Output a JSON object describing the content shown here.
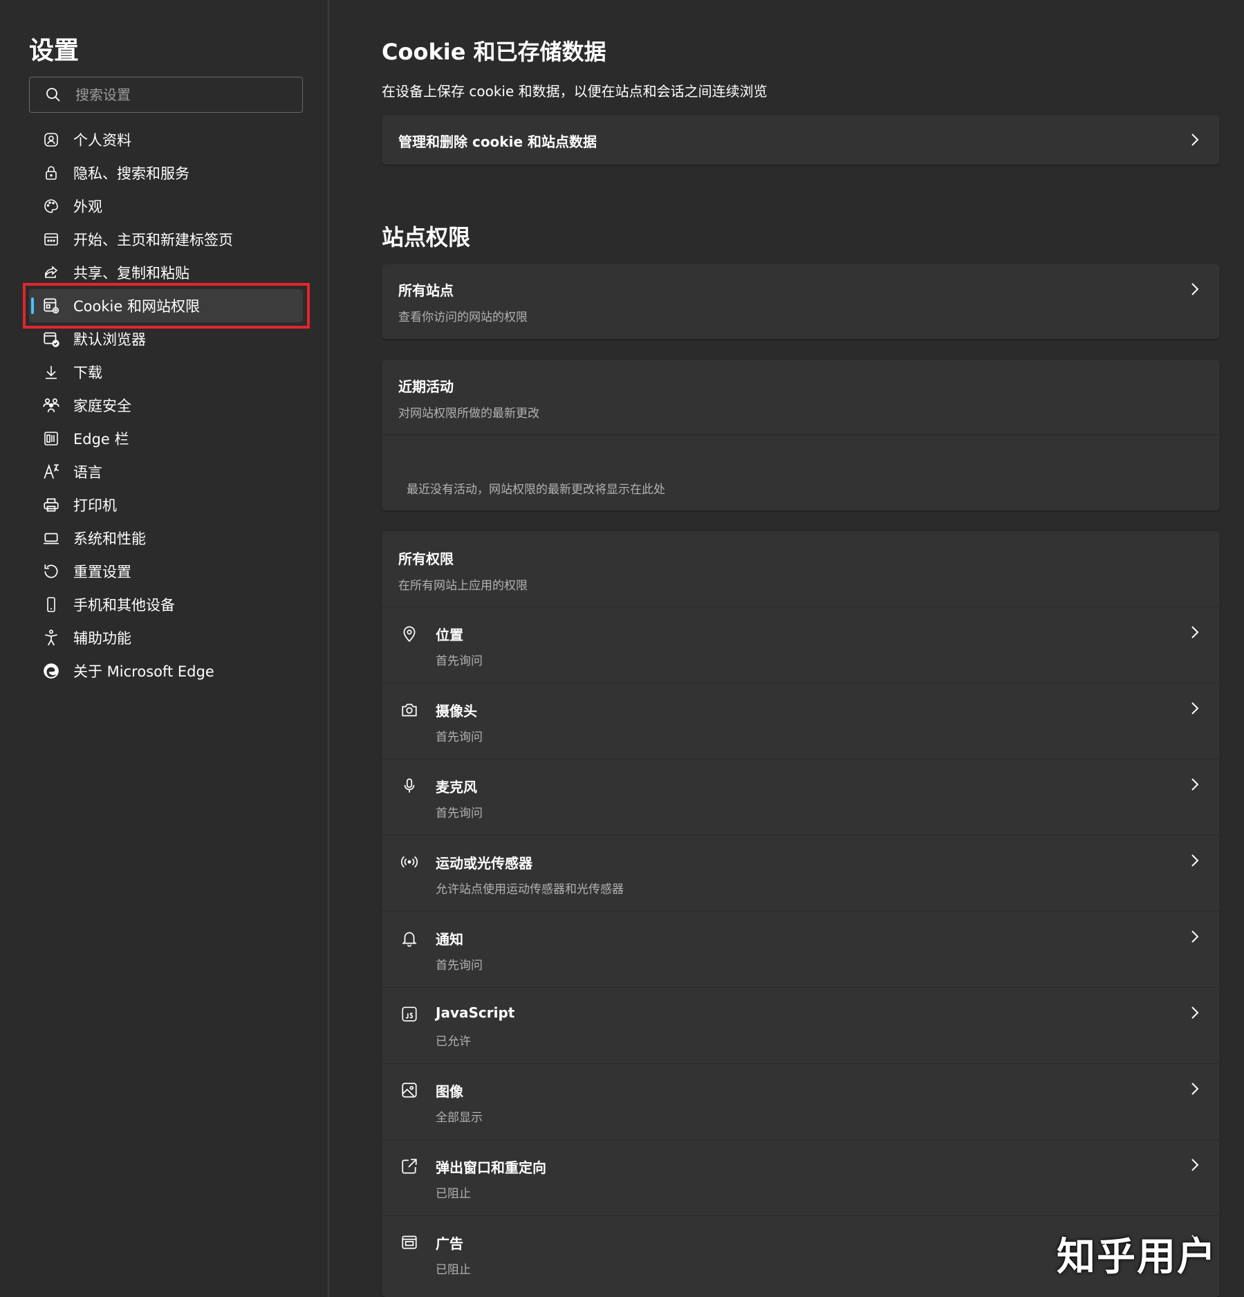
{
  "sidebar": {
    "title": "设置",
    "search_placeholder": "搜索设置",
    "items": [
      {
        "label": "个人资料",
        "icon": "profile-icon"
      },
      {
        "label": "隐私、搜索和服务",
        "icon": "lock-icon"
      },
      {
        "label": "外观",
        "icon": "palette-icon"
      },
      {
        "label": "开始、主页和新建标签页",
        "icon": "start-page-icon"
      },
      {
        "label": "共享、复制和粘贴",
        "icon": "share-icon"
      },
      {
        "label": "Cookie 和网站权限",
        "icon": "site-permissions-icon",
        "active": true
      },
      {
        "label": "默认浏览器",
        "icon": "default-browser-icon"
      },
      {
        "label": "下载",
        "icon": "download-icon"
      },
      {
        "label": "家庭安全",
        "icon": "family-icon"
      },
      {
        "label": "Edge 栏",
        "icon": "edge-bar-icon"
      },
      {
        "label": "语言",
        "icon": "language-icon"
      },
      {
        "label": "打印机",
        "icon": "printer-icon"
      },
      {
        "label": "系统和性能",
        "icon": "laptop-icon"
      },
      {
        "label": "重置设置",
        "icon": "reset-icon"
      },
      {
        "label": "手机和其他设备",
        "icon": "phone-icon"
      },
      {
        "label": "辅助功能",
        "icon": "accessibility-icon"
      },
      {
        "label": "关于 Microsoft Edge",
        "icon": "edge-logo-icon"
      }
    ]
  },
  "main": {
    "cookies": {
      "title": "Cookie 和已存储数据",
      "description": "在设备上保存 cookie 和数据，以便在站点和会话之间连续浏览",
      "manage_label": "管理和删除 cookie 和站点数据"
    },
    "site_permissions": {
      "title": "站点权限",
      "all_sites": {
        "title": "所有站点",
        "subtitle": "查看你访问的网站的权限"
      },
      "recent_activity": {
        "title": "近期活动",
        "subtitle": "对网站权限所做的最新更改",
        "empty_text": "最近没有活动，网站权限的最新更改将显示在此处"
      },
      "all_permissions": {
        "title": "所有权限",
        "subtitle": "在所有网站上应用的权限",
        "items": [
          {
            "title": "位置",
            "subtitle": "首先询问",
            "icon": "location-icon"
          },
          {
            "title": "摄像头",
            "subtitle": "首先询问",
            "icon": "camera-icon"
          },
          {
            "title": "麦克风",
            "subtitle": "首先询问",
            "icon": "microphone-icon"
          },
          {
            "title": "运动或光传感器",
            "subtitle": "允许站点使用运动传感器和光传感器",
            "icon": "sensor-icon"
          },
          {
            "title": "通知",
            "subtitle": "首先询问",
            "icon": "bell-icon"
          },
          {
            "title": "JavaScript",
            "subtitle": "已允许",
            "icon": "javascript-icon"
          },
          {
            "title": "图像",
            "subtitle": "全部显示",
            "icon": "image-icon"
          },
          {
            "title": "弹出窗口和重定向",
            "subtitle": "已阻止",
            "icon": "popup-icon"
          },
          {
            "title": "广告",
            "subtitle": "已阻止",
            "icon": "ads-icon"
          }
        ]
      }
    }
  },
  "watermark": "知乎用户",
  "colors": {
    "background": "#2b2b2b",
    "card": "#333333",
    "accent": "#4cc2ff",
    "highlight_box": "#e0262e",
    "secondary_text": "#b3b3b3"
  }
}
